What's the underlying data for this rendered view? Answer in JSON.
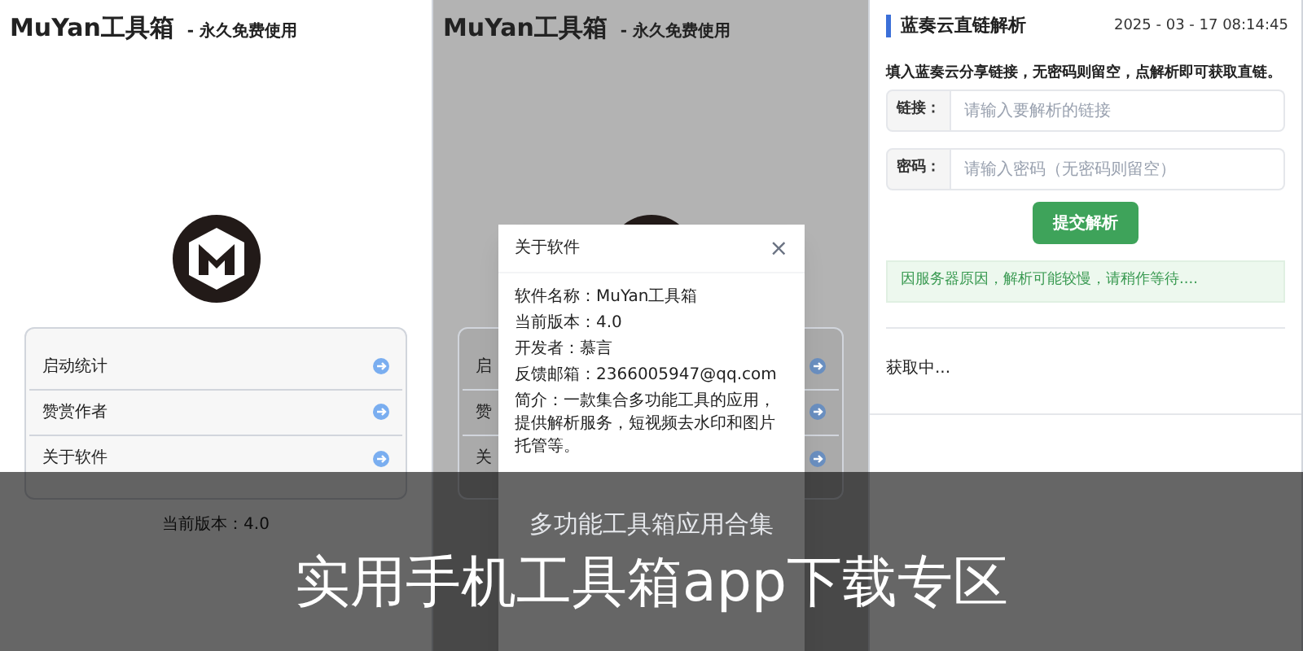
{
  "panels": [
    {
      "kind": "home",
      "dimmed": false,
      "app_title": "MuYan工具箱",
      "app_subtitle": "- 永久免费使用",
      "menu": [
        {
          "label": "启动统计"
        },
        {
          "label": "赞赏作者"
        },
        {
          "label": "关于软件"
        }
      ],
      "version": "当前版本：4.0"
    },
    {
      "kind": "home",
      "dimmed": true,
      "app_title": "MuYan工具箱",
      "app_subtitle": "- 永久免费使用",
      "menu": [
        {
          "label": "启"
        },
        {
          "label": "赞"
        },
        {
          "label": "关"
        }
      ],
      "dialog": {
        "title": "关于软件",
        "close": "×",
        "lines": [
          "软件名称：MuYan工具箱",
          "当前版本：4.0",
          "开发者：慕言",
          "反馈邮箱：2366005947@qq.com",
          "简介：一款集合多功能工具的应用，提供解析服务，短视频去水印和图片托管等。"
        ]
      }
    },
    {
      "kind": "parser",
      "title": "蓝奏云直链解析",
      "datetime": "2025 - 03 - 17 08:14:45",
      "intro": "填入蓝奏云分享链接，无密码则留空，点解析即可获取直链。",
      "fields": [
        {
          "label": "链接：",
          "placeholder": "请输入要解析的链接"
        },
        {
          "label": "密码：",
          "placeholder": "请输入密码（无密码则留空）"
        }
      ],
      "submit": "提交解析",
      "notice": "因服务器原因，解析可能较慢，请稍作等待....",
      "status": "获取中..."
    }
  ],
  "banner": {
    "subtitle": "多功能工具箱应用合集",
    "title": "实用手机工具箱app下载专区"
  }
}
